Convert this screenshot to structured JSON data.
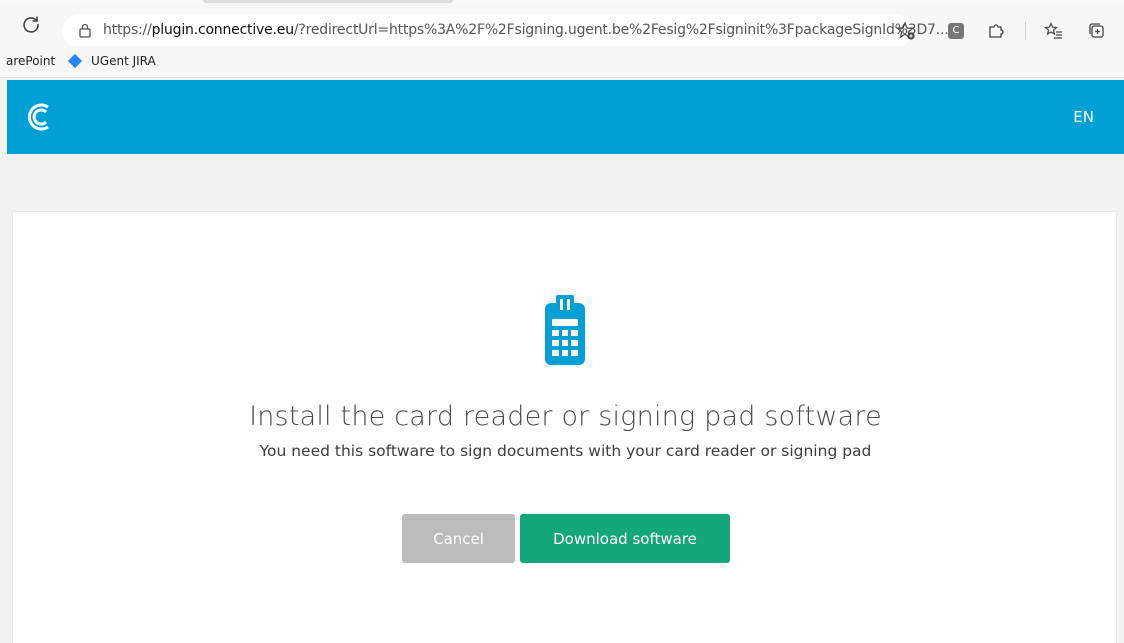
{
  "browser": {
    "url_prefix": "https://",
    "url_host": "plugin.connective.eu",
    "url_rest": "/?redirectUrl=https%3A%2F%2Fsigning.ugent.be%2Fesig%2Fsigninit%3FpackageSignId%3D7...",
    "extension_letter": "C",
    "favorites": [
      {
        "label": "arePoint"
      },
      {
        "label": "UGent JIRA"
      }
    ]
  },
  "app": {
    "language": "EN",
    "brand_color": "#009fd6"
  },
  "main": {
    "title": "Install the card reader or signing pad software",
    "subtitle": "You need this software to sign documents with your card reader or signing pad",
    "cancel_label": "Cancel",
    "download_label": "Download software",
    "download_color": "#13a679",
    "cancel_color": "#bcbcbc"
  }
}
